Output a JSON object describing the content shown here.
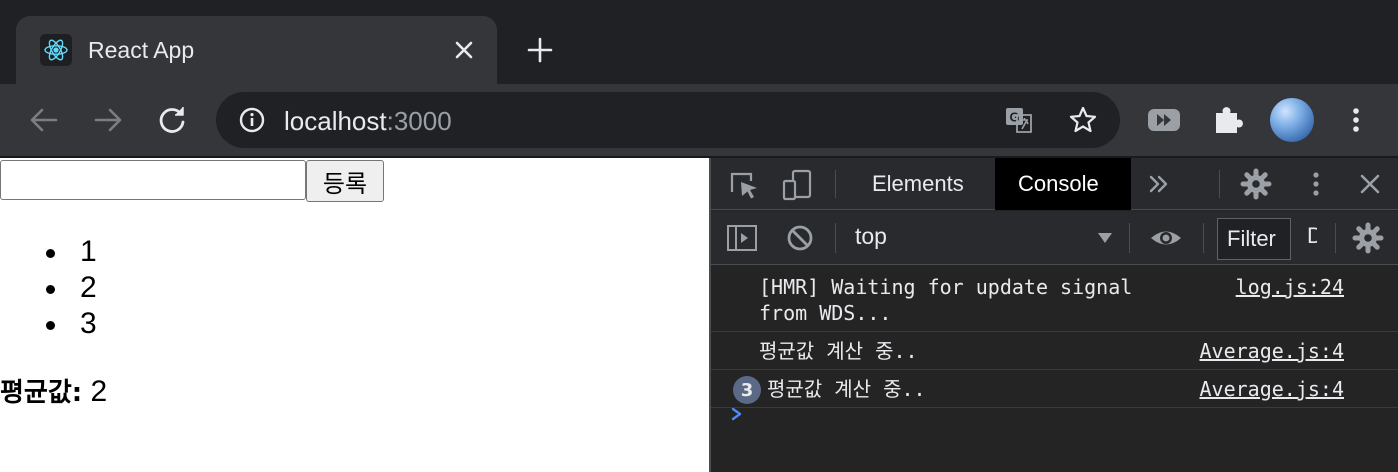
{
  "browser": {
    "tab": {
      "title": "React App",
      "favicon": "react-logo-icon"
    },
    "url": {
      "host": "localhost",
      "port": ":3000"
    }
  },
  "page": {
    "input": {
      "value": "",
      "placeholder": ""
    },
    "submit_label": "등록",
    "list_items": [
      "1",
      "2",
      "3"
    ],
    "average": {
      "label": "평균값:",
      "value": "2"
    }
  },
  "devtools": {
    "tabs": [
      "Elements",
      "Console"
    ],
    "active_tab": "Console",
    "context": "top",
    "filter_label": "Filter",
    "filter_extra": "D",
    "messages": [
      {
        "text": "[HMR] Waiting for update signal\nfrom WDS...",
        "source": "log.js:24",
        "count": ""
      },
      {
        "text": "평균값 계산 중..",
        "source": "Average.js:4",
        "count": ""
      },
      {
        "text": "평균값 계산 중..",
        "source": "Average.js:4",
        "count": "3"
      }
    ]
  },
  "colors": {
    "tab_strip": "#202124",
    "toolbar": "#35363a",
    "devtools_bg": "#242424",
    "prompt_accent": "#4c8bf5",
    "repeat_badge": "#5a6a86"
  }
}
